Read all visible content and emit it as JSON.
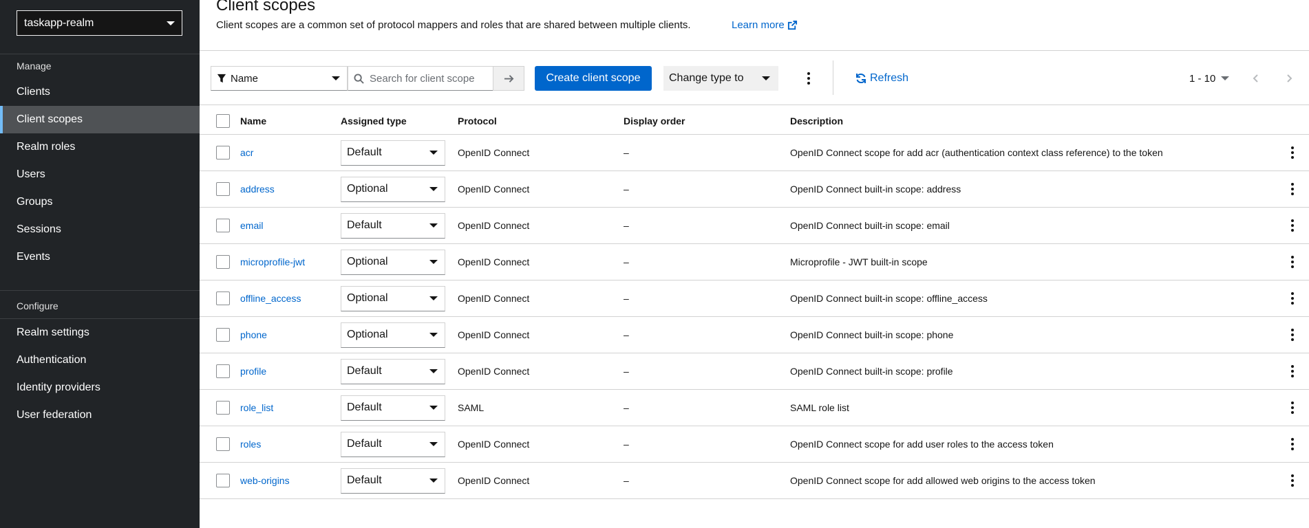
{
  "sidebar": {
    "realm": "taskapp-realm",
    "manage_title": "Manage",
    "manage_items": [
      {
        "label": "Clients",
        "active": false
      },
      {
        "label": "Client scopes",
        "active": true
      },
      {
        "label": "Realm roles",
        "active": false
      },
      {
        "label": "Users",
        "active": false
      },
      {
        "label": "Groups",
        "active": false
      },
      {
        "label": "Sessions",
        "active": false
      },
      {
        "label": "Events",
        "active": false
      }
    ],
    "configure_title": "Configure",
    "configure_items": [
      {
        "label": "Realm settings"
      },
      {
        "label": "Authentication"
      },
      {
        "label": "Identity providers"
      },
      {
        "label": "User federation"
      }
    ]
  },
  "header": {
    "title": "Client scopes",
    "description": "Client scopes are a common set of protocol mappers and roles that are shared between multiple clients.",
    "learn_more": "Learn more"
  },
  "toolbar": {
    "filter_label": "Name",
    "search_placeholder": "Search for client scope",
    "create_label": "Create client scope",
    "change_type_label": "Change type to",
    "refresh_label": "Refresh",
    "pagination_label": "1 - 10"
  },
  "table": {
    "columns": [
      "Name",
      "Assigned type",
      "Protocol",
      "Display order",
      "Description"
    ],
    "rows": [
      {
        "name": "acr",
        "type": "Default",
        "protocol": "OpenID Connect",
        "order": "–",
        "description": "OpenID Connect scope for add acr (authentication context class reference) to the token"
      },
      {
        "name": "address",
        "type": "Optional",
        "protocol": "OpenID Connect",
        "order": "–",
        "description": "OpenID Connect built-in scope: address"
      },
      {
        "name": "email",
        "type": "Default",
        "protocol": "OpenID Connect",
        "order": "–",
        "description": "OpenID Connect built-in scope: email"
      },
      {
        "name": "microprofile-jwt",
        "type": "Optional",
        "protocol": "OpenID Connect",
        "order": "–",
        "description": "Microprofile - JWT built-in scope"
      },
      {
        "name": "offline_access",
        "type": "Optional",
        "protocol": "OpenID Connect",
        "order": "–",
        "description": "OpenID Connect built-in scope: offline_access"
      },
      {
        "name": "phone",
        "type": "Optional",
        "protocol": "OpenID Connect",
        "order": "–",
        "description": "OpenID Connect built-in scope: phone"
      },
      {
        "name": "profile",
        "type": "Default",
        "protocol": "OpenID Connect",
        "order": "–",
        "description": "OpenID Connect built-in scope: profile"
      },
      {
        "name": "role_list",
        "type": "Default",
        "protocol": "SAML",
        "order": "–",
        "description": "SAML role list"
      },
      {
        "name": "roles",
        "type": "Default",
        "protocol": "OpenID Connect",
        "order": "–",
        "description": "OpenID Connect scope for add user roles to the access token"
      },
      {
        "name": "web-origins",
        "type": "Default",
        "protocol": "OpenID Connect",
        "order": "–",
        "description": "OpenID Connect scope for add allowed web origins to the access token"
      }
    ]
  },
  "colors": {
    "sidebar_bg": "#212427",
    "primary": "#0066cc",
    "active_nav": "#4f5255"
  }
}
